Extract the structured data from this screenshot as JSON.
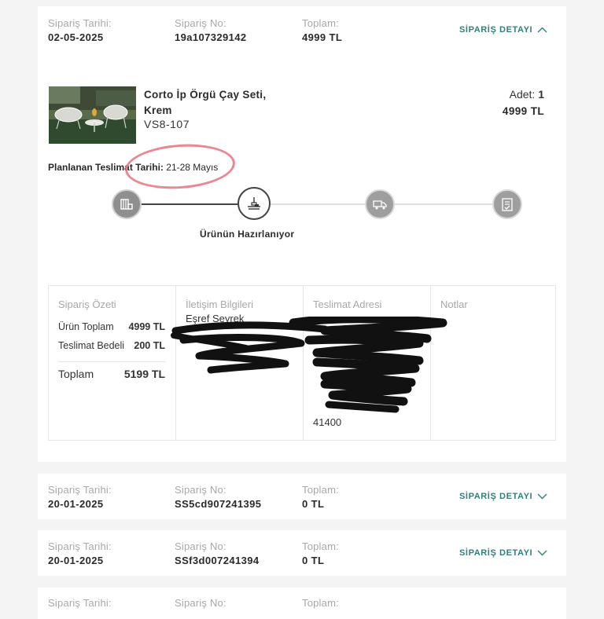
{
  "orders": [
    {
      "date_label": "Sipariş Tarihi:",
      "date": "02-05-2025",
      "no_label": "Sipariş No:",
      "no": "19a107329142",
      "total_label": "Toplam:",
      "total": "4999 TL",
      "detail_label": "SİPARİŞ DETAYI",
      "expanded": true
    },
    {
      "date_label": "Sipariş Tarihi:",
      "date": "20-01-2025",
      "no_label": "Sipariş No:",
      "no": "SS5cd907241395",
      "total_label": "Toplam:",
      "total": "0 TL",
      "detail_label": "SİPARİŞ DETAYI",
      "expanded": false
    },
    {
      "date_label": "Sipariş Tarihi:",
      "date": "20-01-2025",
      "no_label": "Sipariş No:",
      "no": "SSf3d007241394",
      "total_label": "Toplam:",
      "total": "0 TL",
      "detail_label": "SİPARİŞ DETAYI",
      "expanded": false
    },
    {
      "date_label": "Sipariş Tarihi:",
      "no_label": "Sipariş No:",
      "total_label": "Toplam:"
    }
  ],
  "product": {
    "name": "Corto İp Örgü Çay Seti, Krem",
    "code": "VS8-107",
    "qty_label": "Adet:",
    "qty": "1",
    "price": "4999 TL",
    "image_icon": "garden-chairs-photo"
  },
  "delivery": {
    "label": "Planlanan Teslimat Tarihi:",
    "value": "21-28 Mayıs"
  },
  "tracking": {
    "current_label": "Ürünün Hazırlanıyor",
    "steps": [
      {
        "icon": "order-received-icon",
        "state": "done"
      },
      {
        "icon": "preparing-icon",
        "state": "active"
      },
      {
        "icon": "truck-icon",
        "state": "todo"
      },
      {
        "icon": "delivered-icon",
        "state": "todo"
      }
    ]
  },
  "summary": {
    "title": "Sipariş Özeti",
    "product_total_label": "Ürün Toplam",
    "product_total": "4999 TL",
    "shipping_label": "Teslimat Bedeli",
    "shipping": "200 TL",
    "total_label": "Toplam",
    "total": "5199 TL"
  },
  "contact": {
    "title": "İletişim Bilgileri",
    "name": "Eşref Seyrek"
  },
  "address": {
    "title": "Teslimat Adresi",
    "zip": "41400"
  },
  "notes": {
    "title": "Notlar"
  },
  "colors": {
    "accent": "#2f7f7a",
    "annotation": "#e9727e",
    "background": "#f4f4f4"
  }
}
